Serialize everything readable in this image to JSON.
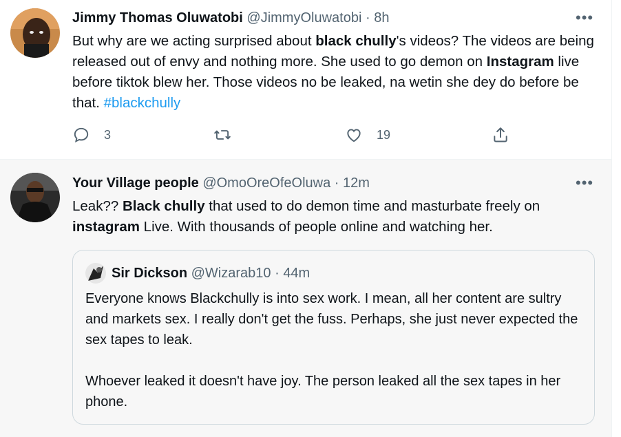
{
  "tweet1": {
    "name": "Jimmy Thomas Oluwatobi",
    "handle": "@JimmyOluwatobi",
    "sep": "·",
    "time": "8h",
    "more_icon": "more-horizontal-icon",
    "text": {
      "p1": "But why are we acting surprised about ",
      "b1": "black chully",
      "p2": "'s videos? The videos are being released out of envy and nothing more. She used to go demon on ",
      "b2": "Instagram",
      "p3": " live before tiktok blew her. Those videos no be leaked, na wetin she dey do before be that. ",
      "hashtag": "#blackchully"
    },
    "actions": {
      "reply_count": "3",
      "retweet_count": "",
      "like_count": "19"
    }
  },
  "tweet2": {
    "name": "Your Village people",
    "handle": "@OmoOreOfeOluwa",
    "sep": "·",
    "time": "12m",
    "text": {
      "p1": "Leak?? ",
      "b1": "Black chully",
      "p2": " that used to do demon time and masturbate freely on ",
      "b2": "instagram",
      "p3": " Live. With thousands of people online and watching her."
    },
    "quote": {
      "name": "Sir Dickson",
      "handle": "@Wizarab10",
      "sep": "·",
      "time": "44m",
      "para1": "Everyone knows Blackchully is into sex work. I mean, all her content are sultry and markets sex. I really don't get the fuss. Perhaps, she just never expected the sex tapes to leak.",
      "para2": "Whoever leaked it doesn't have joy. The person leaked all the sex tapes in her phone."
    }
  },
  "colors": {
    "accent": "#1d9bf0",
    "secondary_text": "#536471",
    "highlight_bg": "#f7f7f7"
  }
}
